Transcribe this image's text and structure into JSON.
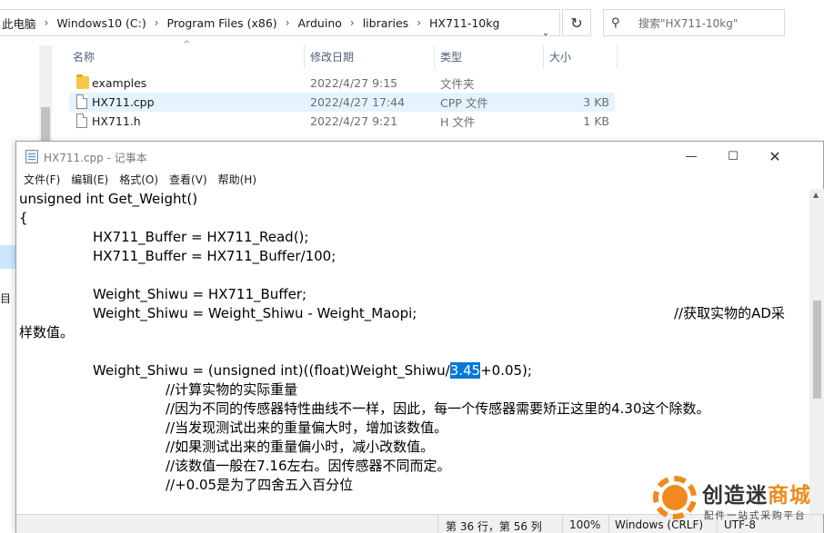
{
  "explorer": {
    "breadcrumb": [
      "此电脑",
      "Windows10 (C:)",
      "Program Files (x86)",
      "Arduino",
      "libraries",
      "HX711-10kg"
    ],
    "search_placeholder": "搜索\"HX711-10kg\"",
    "columns": [
      "名称",
      "修改日期",
      "类型",
      "大小"
    ],
    "files": [
      {
        "name": "examples",
        "date": "2022/4/27 9:15",
        "type": "文件夹",
        "size": "",
        "icon": "folder-icon"
      },
      {
        "name": "HX711.cpp",
        "date": "2022/4/27 17:44",
        "type": "CPP 文件",
        "size": "3 KB",
        "icon": "file-icon"
      },
      {
        "name": "HX711.h",
        "date": "2022/4/27 9:21",
        "type": "H 文件",
        "size": "1 KB",
        "icon": "file-icon"
      }
    ],
    "left_pane_text": "目"
  },
  "notepad": {
    "title": "HX711.cpp - 记事本",
    "menu": [
      "文件(F)",
      "编辑(E)",
      "格式(O)",
      "查看(V)",
      "帮助(H)"
    ],
    "code": {
      "l1": "unsigned int Get_Weight()",
      "l2": "{",
      "l3": "HX711_Buffer = HX711_Read();",
      "l4": "HX711_Buffer = HX711_Buffer/100;",
      "l5": "Weight_Shiwu = HX711_Buffer;",
      "l6": "Weight_Shiwu = Weight_Shiwu - Weight_Maopi;",
      "l6_comment": "//获取实物的AD采",
      "l7": "样数值。",
      "l8_pre": "Weight_Shiwu = (unsigned int)((float)Weight_Shiwu/",
      "l8_sel": "3.45",
      "l8_post": "+0.05);",
      "c1": "//计算实物的实际重量",
      "c2": "//因为不同的传感器特性曲线不一样，因此，每一个传感器需要矫正这里的4.30这个除数。",
      "c3": "//当发现测试出来的重量偏大时，增加该数值。",
      "c4": "//如果测试出来的重量偏小时，减小改数值。",
      "c5": "//该数值一般在7.16左右。因传感器不同而定。",
      "c6": "//+0.05是为了四舍五入百分位"
    },
    "status": {
      "position": "第 36 行，第 56 列",
      "zoom": "100%",
      "line_ending": "Windows (CRLF)",
      "encoding": "UTF-8"
    }
  },
  "watermark": {
    "title_dark": "创造迷",
    "title_orange": "商城",
    "subtitle": "配件一站式采购平台"
  },
  "colors": {
    "selection": "#0078d7",
    "row_selected": "#e5f3ff",
    "brand_orange": "#f08a1e"
  }
}
